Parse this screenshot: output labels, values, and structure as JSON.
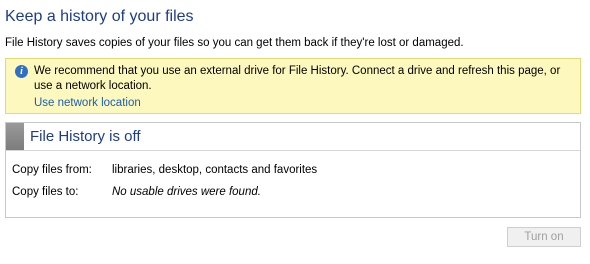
{
  "header": {
    "title": "Keep a history of your files",
    "description": "File History saves copies of your files so you can get them back if they're lost or damaged."
  },
  "info_bar": {
    "icon": "info-icon",
    "icon_glyph": "i",
    "message": "We recommend that you use an external drive for File History. Connect a drive and refresh this page, or use a network location.",
    "link_label": "Use network location"
  },
  "status": {
    "title": "File History is off",
    "copy_from_label": "Copy files from:",
    "copy_from_value": "libraries, desktop, contacts and favorites",
    "copy_to_label": "Copy files to:",
    "copy_to_value": "No usable drives were found."
  },
  "actions": {
    "turn_on_label": "Turn on",
    "turn_on_enabled": false
  },
  "colors": {
    "title_blue": "#1e3c8c",
    "info_background": "#fcf8be",
    "link_blue": "#1a5fb4"
  }
}
